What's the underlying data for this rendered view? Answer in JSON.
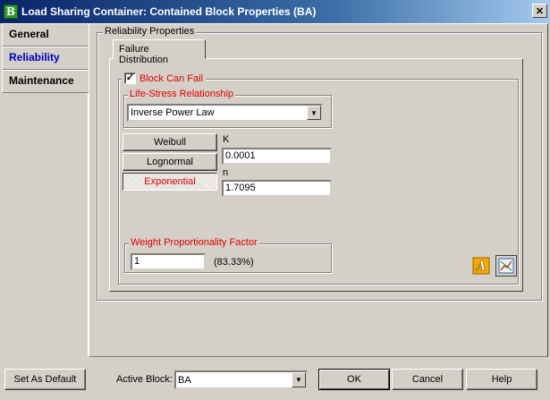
{
  "window": {
    "title": "Load Sharing Container: Contained Block Properties (BA)",
    "close_glyph": "✕",
    "app_icon_letter": "B"
  },
  "sidebar": {
    "items": [
      {
        "label": "General"
      },
      {
        "label": "Reliability"
      },
      {
        "label": "Maintenance"
      }
    ]
  },
  "reliability": {
    "group_label": "Reliability Properties",
    "tab_label": "Failure Distribution",
    "block_can_fail_label": "Block Can Fail",
    "block_can_fail_checked": true,
    "check_glyph": "✓",
    "life_stress": {
      "label": "Life-Stress Relationship",
      "selected": "Inverse Power Law",
      "dropdown_glyph": "▼"
    },
    "distributions": [
      {
        "label": "Weibull"
      },
      {
        "label": "Lognormal"
      },
      {
        "label": "Exponential"
      }
    ],
    "params": {
      "k_label": "K",
      "k_value": "0.0001",
      "n_label": "n",
      "n_value": "1.7095"
    },
    "weight": {
      "label": "Weight Proportionality Factor",
      "value": "1",
      "percent": "(83.33%)"
    }
  },
  "footer": {
    "set_default_label": "Set As Default",
    "active_block_label": "Active Block:",
    "active_block_value": "BA",
    "dropdown_glyph": "▼",
    "ok_label": "OK",
    "cancel_label": "Cancel",
    "help_label": "Help"
  },
  "colors": {
    "accent_red": "#e00000",
    "active_tab_blue": "#0000cc",
    "title_bar": "#0a246a"
  }
}
